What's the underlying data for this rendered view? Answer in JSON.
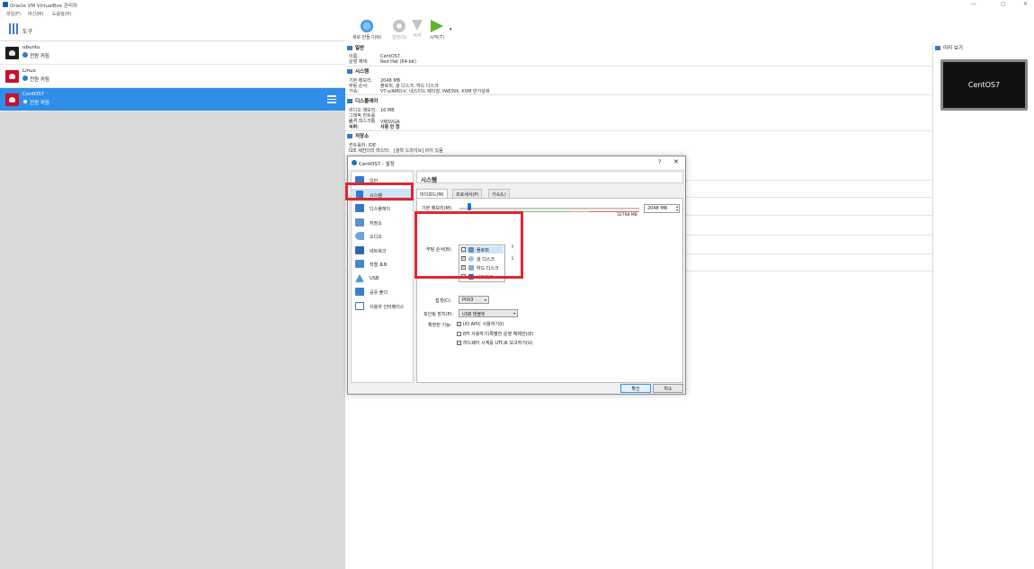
{
  "window": {
    "title": "Oracle VM VirtualBox 관리자",
    "minimize": "—",
    "maximize": "▢",
    "close": "✕"
  },
  "menu": [
    "파일(F)",
    "머신(M)",
    "도움말(H)"
  ],
  "tools": {
    "label": "도구"
  },
  "vms": [
    {
      "name": "ubuntu",
      "state": "전원 꺼짐"
    },
    {
      "name": "Linux",
      "state": "전원 꺼짐"
    },
    {
      "name": "CentOS7",
      "state": "전원 꺼짐"
    }
  ],
  "toolbar": {
    "new": "새로 만들기(N)",
    "settings": "설정(S)",
    "discard": "삭제",
    "start": "시작(T)",
    "start_arrow": "▾"
  },
  "details": {
    "general": {
      "header": "일반",
      "name_k": "이름:",
      "name_v": "CentOS7",
      "os_k": "운영 체제:",
      "os_v": "Red Hat (64-bit)"
    },
    "system": {
      "header": "시스템",
      "mem_k": "기본 메모리:",
      "mem_v": "2048 MB",
      "boot_k": "부팅 순서:",
      "boot_v": "플로피, 광 디스크, 하드 디스크",
      "accel_k": "가속:",
      "accel_v": "VT-x/AMD-V, 네스티드 페이징, PAE/NX, KVM 반가상화"
    },
    "display": {
      "header": "디스플레이",
      "vram_k": "비디오 메모리:",
      "vram_v": "16 MB",
      "gc_k": "그래픽 컨트롤러:",
      "gc_v": "VMSVGA",
      "rdp_k": "원격 데스크톱 서버:",
      "rdp_v": "사용 안 함",
      "rec_k": "녹화:",
      "rec_v": "사용 안 함"
    },
    "storage": {
      "header": "저장소",
      "ctrl": "컨트롤러: IDE",
      "ide_k": "IDE 세컨더리 마스터:",
      "ide_v": "[광학 드라이브] 비어 있음"
    }
  },
  "preview": {
    "header": "미리 보기",
    "screen": "CentOS7"
  },
  "dialog": {
    "title": "CentOS7 - 설정",
    "help": "?",
    "close": "✕",
    "nav": [
      "일반",
      "시스템",
      "디스플레이",
      "저장소",
      "오디오",
      "네트워크",
      "직렬 포트",
      "USB",
      "공유 폴더",
      "사용자 인터페이스"
    ],
    "section_title": "시스템",
    "tabs": [
      "마더보드(M)",
      "프로세서(P)",
      "가속(L)"
    ],
    "mem_label": "기본 메모리(M):",
    "mem_value": "2048 MB",
    "mem_max": "32768 MB",
    "boot_label": "부팅 순서(B):",
    "boot_items": [
      {
        "label": "플로피",
        "checked": ""
      },
      {
        "label": "광 디스크",
        "checked": "✓"
      },
      {
        "label": "하드 디스크",
        "checked": "✓"
      },
      {
        "label": "네트워크",
        "checked": ""
      }
    ],
    "move_up": "⇧",
    "move_down": "⇩",
    "chipset_label": "칩셋(C):",
    "chipset_value": "PIIX3",
    "pointing_label": "포인팅 장치(P):",
    "pointing_value": "USB 태블릿",
    "ext_label": "확장된 기능:",
    "ext_opts": [
      {
        "label": "I/O APIC 사용하기(I)",
        "checked": "✓"
      },
      {
        "label": "EFI 사용하기(특별한 운영 체제만)(E)",
        "checked": ""
      },
      {
        "label": "하드웨어 시계를 UTC로 보고하기(U)",
        "checked": "✓"
      }
    ],
    "ok": "확인",
    "cancel": "취소",
    "caret": "▾"
  },
  "colors": {
    "accent": "#2e8ee8",
    "highlight": "#e0262e"
  }
}
